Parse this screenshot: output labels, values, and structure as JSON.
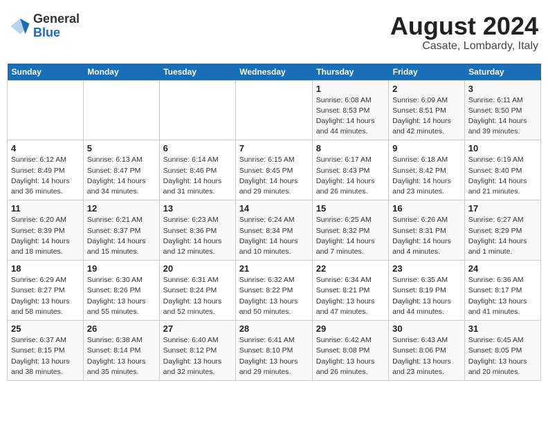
{
  "header": {
    "logo_general": "General",
    "logo_blue": "Blue",
    "month_year": "August 2024",
    "location": "Casate, Lombardy, Italy"
  },
  "days_of_week": [
    "Sunday",
    "Monday",
    "Tuesday",
    "Wednesday",
    "Thursday",
    "Friday",
    "Saturday"
  ],
  "weeks": [
    [
      {
        "day": "",
        "info": ""
      },
      {
        "day": "",
        "info": ""
      },
      {
        "day": "",
        "info": ""
      },
      {
        "day": "",
        "info": ""
      },
      {
        "day": "1",
        "info": "Sunrise: 6:08 AM\nSunset: 8:53 PM\nDaylight: 14 hours\nand 44 minutes."
      },
      {
        "day": "2",
        "info": "Sunrise: 6:09 AM\nSunset: 8:51 PM\nDaylight: 14 hours\nand 42 minutes."
      },
      {
        "day": "3",
        "info": "Sunrise: 6:11 AM\nSunset: 8:50 PM\nDaylight: 14 hours\nand 39 minutes."
      }
    ],
    [
      {
        "day": "4",
        "info": "Sunrise: 6:12 AM\nSunset: 8:49 PM\nDaylight: 14 hours\nand 36 minutes."
      },
      {
        "day": "5",
        "info": "Sunrise: 6:13 AM\nSunset: 8:47 PM\nDaylight: 14 hours\nand 34 minutes."
      },
      {
        "day": "6",
        "info": "Sunrise: 6:14 AM\nSunset: 8:46 PM\nDaylight: 14 hours\nand 31 minutes."
      },
      {
        "day": "7",
        "info": "Sunrise: 6:15 AM\nSunset: 8:45 PM\nDaylight: 14 hours\nand 29 minutes."
      },
      {
        "day": "8",
        "info": "Sunrise: 6:17 AM\nSunset: 8:43 PM\nDaylight: 14 hours\nand 26 minutes."
      },
      {
        "day": "9",
        "info": "Sunrise: 6:18 AM\nSunset: 8:42 PM\nDaylight: 14 hours\nand 23 minutes."
      },
      {
        "day": "10",
        "info": "Sunrise: 6:19 AM\nSunset: 8:40 PM\nDaylight: 14 hours\nand 21 minutes."
      }
    ],
    [
      {
        "day": "11",
        "info": "Sunrise: 6:20 AM\nSunset: 8:39 PM\nDaylight: 14 hours\nand 18 minutes."
      },
      {
        "day": "12",
        "info": "Sunrise: 6:21 AM\nSunset: 8:37 PM\nDaylight: 14 hours\nand 15 minutes."
      },
      {
        "day": "13",
        "info": "Sunrise: 6:23 AM\nSunset: 8:36 PM\nDaylight: 14 hours\nand 12 minutes."
      },
      {
        "day": "14",
        "info": "Sunrise: 6:24 AM\nSunset: 8:34 PM\nDaylight: 14 hours\nand 10 minutes."
      },
      {
        "day": "15",
        "info": "Sunrise: 6:25 AM\nSunset: 8:32 PM\nDaylight: 14 hours\nand 7 minutes."
      },
      {
        "day": "16",
        "info": "Sunrise: 6:26 AM\nSunset: 8:31 PM\nDaylight: 14 hours\nand 4 minutes."
      },
      {
        "day": "17",
        "info": "Sunrise: 6:27 AM\nSunset: 8:29 PM\nDaylight: 14 hours\nand 1 minute."
      }
    ],
    [
      {
        "day": "18",
        "info": "Sunrise: 6:29 AM\nSunset: 8:27 PM\nDaylight: 13 hours\nand 58 minutes."
      },
      {
        "day": "19",
        "info": "Sunrise: 6:30 AM\nSunset: 8:26 PM\nDaylight: 13 hours\nand 55 minutes."
      },
      {
        "day": "20",
        "info": "Sunrise: 6:31 AM\nSunset: 8:24 PM\nDaylight: 13 hours\nand 52 minutes."
      },
      {
        "day": "21",
        "info": "Sunrise: 6:32 AM\nSunset: 8:22 PM\nDaylight: 13 hours\nand 50 minutes."
      },
      {
        "day": "22",
        "info": "Sunrise: 6:34 AM\nSunset: 8:21 PM\nDaylight: 13 hours\nand 47 minutes."
      },
      {
        "day": "23",
        "info": "Sunrise: 6:35 AM\nSunset: 8:19 PM\nDaylight: 13 hours\nand 44 minutes."
      },
      {
        "day": "24",
        "info": "Sunrise: 6:36 AM\nSunset: 8:17 PM\nDaylight: 13 hours\nand 41 minutes."
      }
    ],
    [
      {
        "day": "25",
        "info": "Sunrise: 6:37 AM\nSunset: 8:15 PM\nDaylight: 13 hours\nand 38 minutes."
      },
      {
        "day": "26",
        "info": "Sunrise: 6:38 AM\nSunset: 8:14 PM\nDaylight: 13 hours\nand 35 minutes."
      },
      {
        "day": "27",
        "info": "Sunrise: 6:40 AM\nSunset: 8:12 PM\nDaylight: 13 hours\nand 32 minutes."
      },
      {
        "day": "28",
        "info": "Sunrise: 6:41 AM\nSunset: 8:10 PM\nDaylight: 13 hours\nand 29 minutes."
      },
      {
        "day": "29",
        "info": "Sunrise: 6:42 AM\nSunset: 8:08 PM\nDaylight: 13 hours\nand 26 minutes."
      },
      {
        "day": "30",
        "info": "Sunrise: 6:43 AM\nSunset: 8:06 PM\nDaylight: 13 hours\nand 23 minutes."
      },
      {
        "day": "31",
        "info": "Sunrise: 6:45 AM\nSunset: 8:05 PM\nDaylight: 13 hours\nand 20 minutes."
      }
    ]
  ]
}
